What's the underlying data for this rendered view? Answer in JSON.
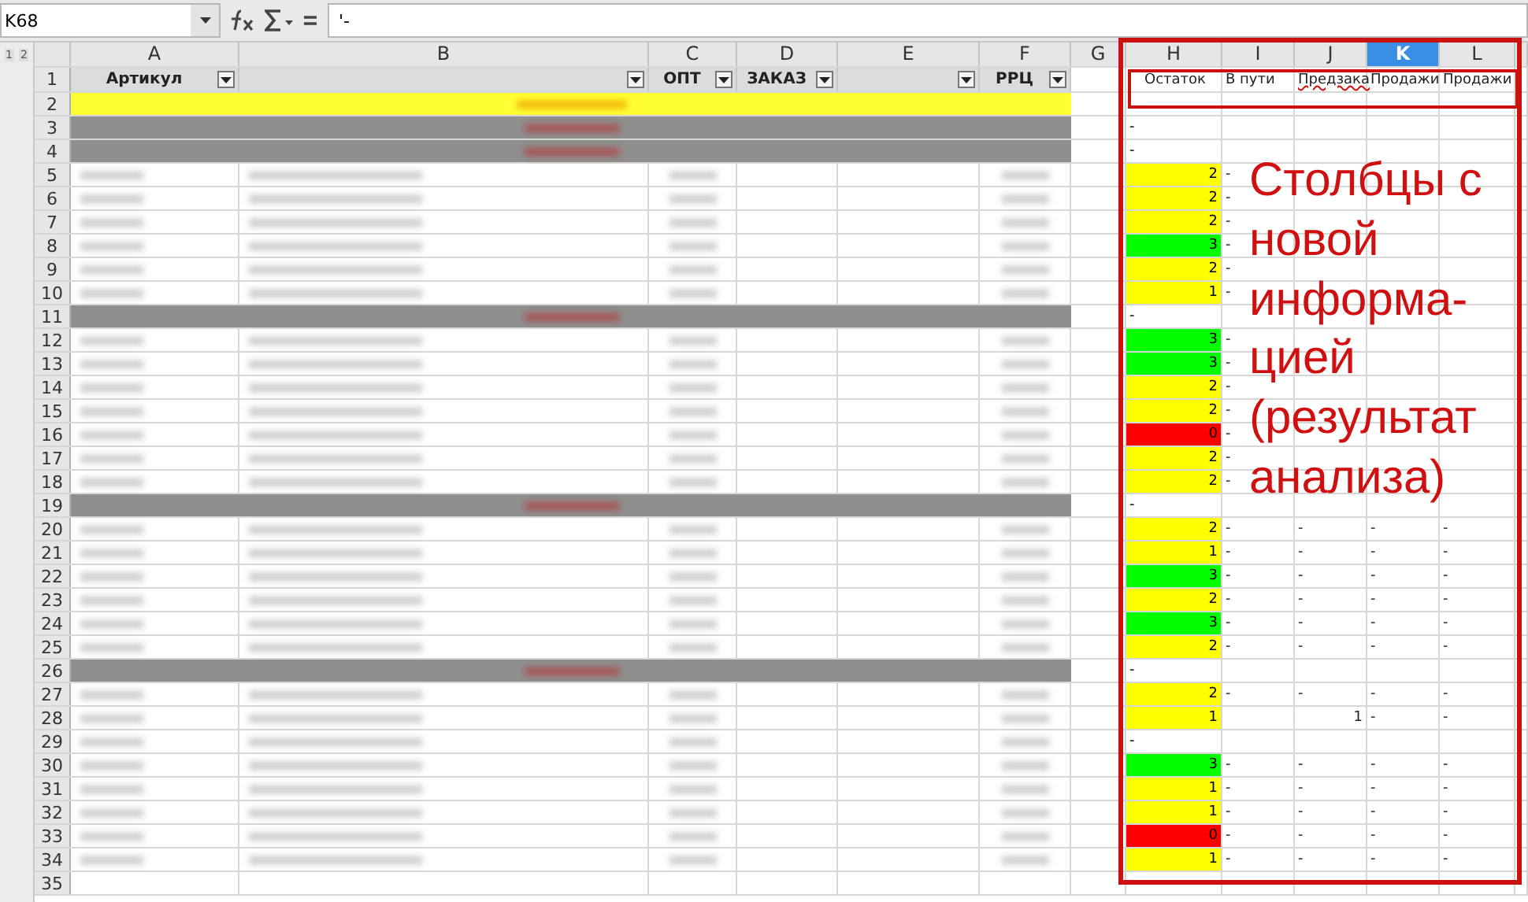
{
  "toolbar": {
    "cell_ref": "K68",
    "formula": "'-"
  },
  "outline_levels": [
    "1",
    "2"
  ],
  "columns": [
    {
      "label": "A",
      "selected": false
    },
    {
      "label": "B",
      "selected": false
    },
    {
      "label": "C",
      "selected": false
    },
    {
      "label": "D",
      "selected": false
    },
    {
      "label": "E",
      "selected": false
    },
    {
      "label": "F",
      "selected": false
    },
    {
      "label": "G",
      "selected": false
    },
    {
      "label": "H",
      "selected": false
    },
    {
      "label": "I",
      "selected": false
    },
    {
      "label": "J",
      "selected": false
    },
    {
      "label": "K",
      "selected": true
    },
    {
      "label": "L",
      "selected": false
    }
  ],
  "header_row": {
    "number": "1",
    "left_cells": [
      {
        "text": "Артикул",
        "filter": true
      },
      {
        "filter": true
      },
      {
        "text": "ОПТ",
        "filter": true
      },
      {
        "text": "ЗАКАЗ",
        "filter": true
      },
      {
        "filter": true
      },
      {
        "text": "РРЦ",
        "filter": true
      }
    ],
    "analysis_cells": [
      "Остаток",
      "В пути",
      "Предзака",
      "Продажи",
      "Продажи"
    ]
  },
  "rows": [
    {
      "number": "2",
      "kind": "highlight"
    },
    {
      "number": "3",
      "kind": "group",
      "h": {
        "value": "-"
      }
    },
    {
      "number": "4",
      "kind": "group",
      "h": {
        "value": "-"
      }
    },
    {
      "number": "5",
      "kind": "item",
      "h": {
        "value": "2",
        "color": "#ffff00"
      },
      "i": "-"
    },
    {
      "number": "6",
      "kind": "item",
      "h": {
        "value": "2",
        "color": "#ffff00"
      },
      "i": "-"
    },
    {
      "number": "7",
      "kind": "item",
      "h": {
        "value": "2",
        "color": "#ffff00"
      },
      "i": "-"
    },
    {
      "number": "8",
      "kind": "item",
      "h": {
        "value": "3",
        "color": "#00ff00"
      },
      "i": "-"
    },
    {
      "number": "9",
      "kind": "item",
      "h": {
        "value": "2",
        "color": "#ffff00"
      },
      "i": "-"
    },
    {
      "number": "10",
      "kind": "item",
      "h": {
        "value": "1",
        "color": "#ffff00"
      },
      "i": "-"
    },
    {
      "number": "11",
      "kind": "group",
      "h": {
        "value": "-"
      }
    },
    {
      "number": "12",
      "kind": "item",
      "h": {
        "value": "3",
        "color": "#00ff00"
      },
      "i": "-"
    },
    {
      "number": "13",
      "kind": "item",
      "h": {
        "value": "3",
        "color": "#00ff00"
      },
      "i": "-"
    },
    {
      "number": "14",
      "kind": "item",
      "h": {
        "value": "2",
        "color": "#ffff00"
      },
      "i": "-"
    },
    {
      "number": "15",
      "kind": "item",
      "h": {
        "value": "2",
        "color": "#ffff00"
      },
      "i": "-"
    },
    {
      "number": "16",
      "kind": "item",
      "h": {
        "value": "0",
        "color": "#ff0000"
      },
      "i": "-"
    },
    {
      "number": "17",
      "kind": "item",
      "h": {
        "value": "2",
        "color": "#ffff00"
      },
      "i": "-"
    },
    {
      "number": "18",
      "kind": "item",
      "h": {
        "value": "2",
        "color": "#ffff00"
      },
      "i": "-"
    },
    {
      "number": "19",
      "kind": "group",
      "h": {
        "value": "-"
      }
    },
    {
      "number": "20",
      "kind": "item",
      "h": {
        "value": "2",
        "color": "#ffff00"
      },
      "i": "-",
      "j": "-",
      "k": "-",
      "l": "-"
    },
    {
      "number": "21",
      "kind": "item",
      "h": {
        "value": "1",
        "color": "#ffff00"
      },
      "i": "-",
      "j": "-",
      "k": "-",
      "l": "-"
    },
    {
      "number": "22",
      "kind": "item",
      "h": {
        "value": "3",
        "color": "#00ff00"
      },
      "i": "-",
      "j": "-",
      "k": "-",
      "l": "-"
    },
    {
      "number": "23",
      "kind": "item",
      "h": {
        "value": "2",
        "color": "#ffff00"
      },
      "i": "-",
      "j": "-",
      "k": "-",
      "l": "-"
    },
    {
      "number": "24",
      "kind": "item",
      "h": {
        "value": "3",
        "color": "#00ff00"
      },
      "i": "-",
      "j": "-",
      "k": "-",
      "l": "-"
    },
    {
      "number": "25",
      "kind": "item",
      "h": {
        "value": "2",
        "color": "#ffff00"
      },
      "i": "-",
      "j": "-",
      "k": "-",
      "l": "-"
    },
    {
      "number": "26",
      "kind": "group",
      "h": {
        "value": "-"
      }
    },
    {
      "number": "27",
      "kind": "item",
      "h": {
        "value": "2",
        "color": "#ffff00"
      },
      "i": "-",
      "j": "-",
      "k": "-",
      "l": "-"
    },
    {
      "number": "28",
      "kind": "item",
      "h": {
        "value": "1",
        "color": "#ffff00"
      },
      "j": "1",
      "k": "-",
      "l": "-"
    },
    {
      "number": "29",
      "kind": "item",
      "h": {
        "value": "-"
      }
    },
    {
      "number": "30",
      "kind": "item",
      "h": {
        "value": "3",
        "color": "#00ff00"
      },
      "i": "-",
      "j": "-",
      "k": "-",
      "l": "-"
    },
    {
      "number": "31",
      "kind": "item",
      "h": {
        "value": "1",
        "color": "#ffff00"
      },
      "i": "-",
      "j": "-",
      "k": "-",
      "l": "-"
    },
    {
      "number": "32",
      "kind": "item",
      "h": {
        "value": "1",
        "color": "#ffff00"
      },
      "i": "-",
      "j": "-",
      "k": "-",
      "l": "-"
    },
    {
      "number": "33",
      "kind": "item",
      "h": {
        "value": "0",
        "color": "#ff0000"
      },
      "i": "-",
      "j": "-",
      "k": "-",
      "l": "-"
    },
    {
      "number": "34",
      "kind": "item",
      "h": {
        "value": "1",
        "color": "#ffff00"
      },
      "i": "-",
      "j": "-",
      "k": "-",
      "l": "-"
    },
    {
      "number": "35",
      "kind": "item"
    }
  ],
  "annotation": {
    "lines": [
      "Столбцы с",
      "новой",
      "информа-",
      "цией",
      "(результат",
      "анализа)"
    ]
  }
}
